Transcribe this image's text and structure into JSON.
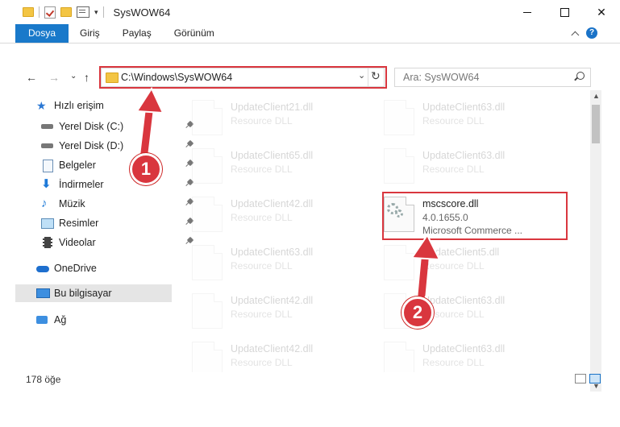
{
  "window": {
    "title": "SysWOW64",
    "minimize_label": "",
    "maximize_label": "",
    "close_label": "✕"
  },
  "ribbon": {
    "tabs": [
      {
        "label": "Dosya"
      },
      {
        "label": "Giriş"
      },
      {
        "label": "Paylaş"
      },
      {
        "label": "Görünüm"
      }
    ],
    "help_label": "?"
  },
  "nav": {
    "back_icon": "←",
    "forward_icon": "→",
    "recent_icon": "⌄",
    "up_icon": "↑"
  },
  "address": {
    "path": "C:\\Windows\\SysWOW64",
    "refresh_icon": "↻",
    "dropdown_icon": "⌄"
  },
  "search": {
    "placeholder": "Ara: SysWOW64"
  },
  "sidebar": {
    "items": [
      {
        "label": "Hızlı erişim",
        "icon": "star-icon"
      },
      {
        "label": "Yerel Disk (C:)",
        "icon": "disk-icon",
        "pinned": true
      },
      {
        "label": "Yerel Disk (D:)",
        "icon": "disk-icon",
        "pinned": true
      },
      {
        "label": "Belgeler",
        "icon": "document-icon",
        "pinned": true
      },
      {
        "label": "İndirmeler",
        "icon": "download-icon",
        "pinned": true
      },
      {
        "label": "Müzik",
        "icon": "music-icon",
        "pinned": true
      },
      {
        "label": "Resimler",
        "icon": "pictures-icon",
        "pinned": true
      },
      {
        "label": "Videolar",
        "icon": "video-icon",
        "pinned": true
      },
      {
        "label": "OneDrive",
        "icon": "cloud-icon"
      },
      {
        "label": "Bu bilgisayar",
        "icon": "computer-icon",
        "selected": true
      },
      {
        "label": "Ağ",
        "icon": "network-icon"
      }
    ]
  },
  "files": {
    "items": [
      {
        "name": "UpdateClient21.dll",
        "desc": "Resource DLL",
        "faded": true
      },
      {
        "name": "UpdateClient63.dll",
        "desc": "Resource DLL",
        "faded": true
      },
      {
        "name": "UpdateClient65.dll",
        "desc": "Resource DLL",
        "faded": true
      },
      {
        "name": "UpdateClient63.dll",
        "desc": "Resource DLL",
        "faded": true
      },
      {
        "name": "UpdateClient42.dll",
        "desc": "Resource DLL",
        "faded": true
      },
      {
        "name": "mscscore.dll",
        "desc": "4.0.1655.0",
        "desc2": "Microsoft Commerce ...",
        "faded": false
      },
      {
        "name": "UpdateClient63.dll",
        "desc": "Resource DLL",
        "faded": true
      },
      {
        "name": "UpdateClient5.dll",
        "desc": "Resource DLL",
        "faded": true
      },
      {
        "name": "UpdateClient42.dll",
        "desc": "Resource DLL",
        "faded": true
      },
      {
        "name": "UpdateClient63.dll",
        "desc": "Resource DLL",
        "faded": true
      },
      {
        "name": "UpdateClient42.dll",
        "desc": "Resource DLL",
        "faded": true
      },
      {
        "name": "UpdateClient63.dll",
        "desc": "Resource DLL",
        "faded": true
      }
    ]
  },
  "status": {
    "count": "178 öğe"
  },
  "callouts": [
    {
      "label": "1"
    },
    {
      "label": "2"
    }
  ],
  "colors": {
    "accent": "#1979ca",
    "highlight": "#d9363e"
  }
}
